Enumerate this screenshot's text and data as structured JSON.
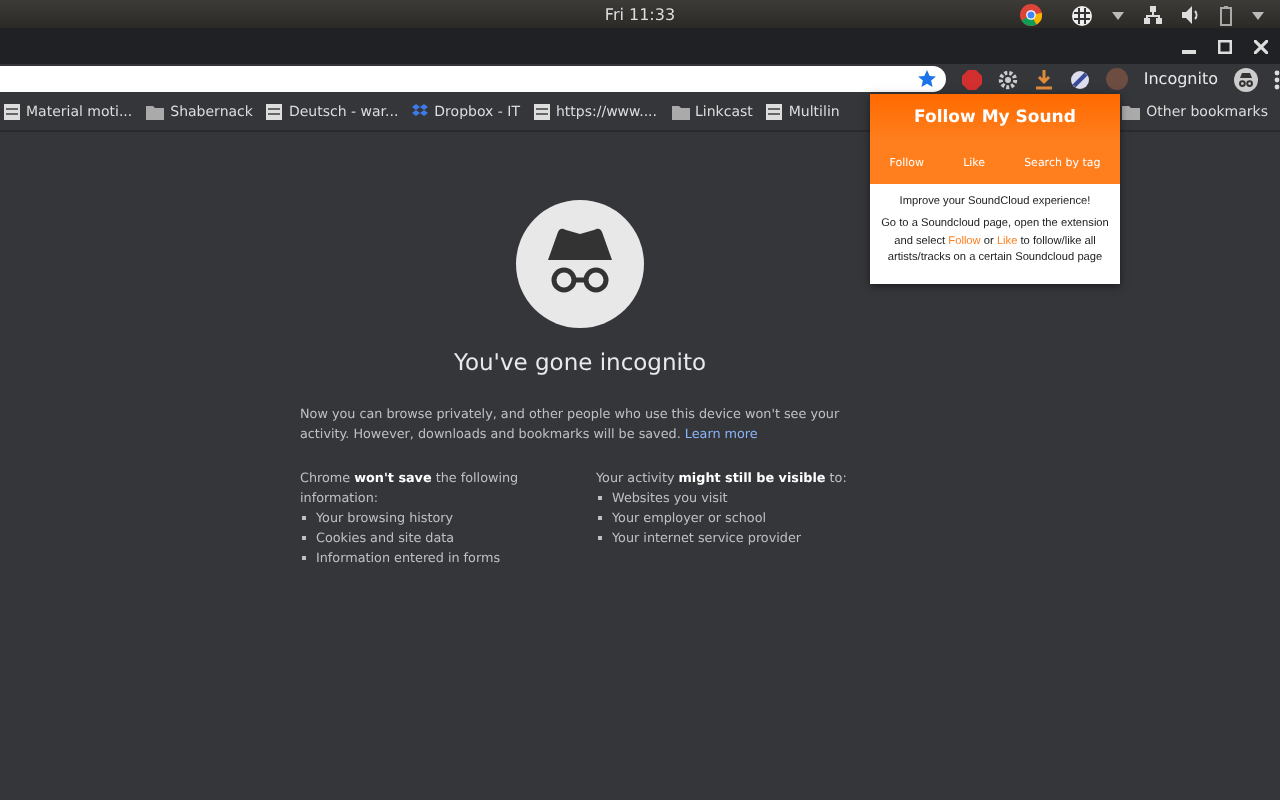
{
  "system_bar": {
    "clock": "Fri 11:33"
  },
  "bookmarks": [
    {
      "label": "Material moti...",
      "kind": "page"
    },
    {
      "label": "Shabernack",
      "kind": "folder"
    },
    {
      "label": "Deutsch - war...",
      "kind": "page"
    },
    {
      "label": "Dropbox - IT",
      "kind": "dropbox"
    },
    {
      "label": "https://www....",
      "kind": "page"
    },
    {
      "label": "Linkcast",
      "kind": "folder"
    },
    {
      "label": "Multilin",
      "kind": "page"
    }
  ],
  "other_bookmarks": "Other bookmarks",
  "profile": {
    "label": "Incognito"
  },
  "incognito": {
    "title": "You've gone incognito",
    "intro": "Now you can browse privately, and other people who use this device won't see your activity. However, downloads and bookmarks will be saved.",
    "learn_more": "Learn more",
    "columns": [
      {
        "heading": "Chrome **won't save** the following information:",
        "items": [
          "Your browsing history",
          "Cookies and site data",
          "Information entered in forms"
        ]
      },
      {
        "heading": "Your activity **might still be visible** to:",
        "items": [
          "Websites you visit",
          "Your employer or school",
          "Your internet service provider"
        ]
      }
    ]
  },
  "popup": {
    "title": "Follow My Sound",
    "tabs": [
      {
        "label": "Follow",
        "selected": false
      },
      {
        "label": "Like",
        "selected": false
      },
      {
        "label": "Search by tag",
        "selected": false
      }
    ],
    "headline": "Improve your SoundCloud experience!",
    "body": [
      {
        "kind": "text",
        "text": "Go to a Soundcloud page, open the extension and select "
      },
      {
        "kind": "link",
        "text": "Follow"
      },
      {
        "kind": "text",
        "text": " or "
      },
      {
        "kind": "link",
        "text": "Like"
      },
      {
        "kind": "text",
        "text": " to follow/like all artists/tracks on a certain Soundcloud page"
      }
    ]
  }
}
